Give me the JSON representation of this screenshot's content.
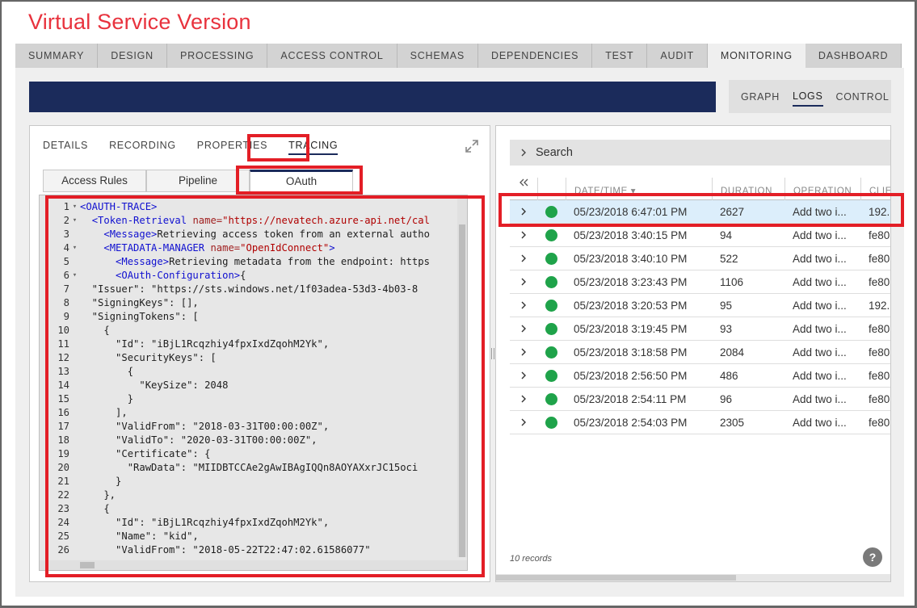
{
  "app": {
    "title": "Virtual Service Version"
  },
  "main_tabs": [
    {
      "label": "SUMMARY"
    },
    {
      "label": "DESIGN"
    },
    {
      "label": "PROCESSING"
    },
    {
      "label": "ACCESS CONTROL"
    },
    {
      "label": "SCHEMAS"
    },
    {
      "label": "DEPENDENCIES"
    },
    {
      "label": "TEST"
    },
    {
      "label": "AUDIT"
    },
    {
      "label": "MONITORING",
      "active": true
    },
    {
      "label": "DASHBOARD"
    }
  ],
  "view_switch": [
    {
      "label": "GRAPH"
    },
    {
      "label": "LOGS",
      "active": true
    },
    {
      "label": "CONTROL"
    }
  ],
  "detail_tabs": [
    {
      "label": "DETAILS"
    },
    {
      "label": "RECORDING"
    },
    {
      "label": "PROPERTIES"
    },
    {
      "label": "TRACING",
      "active": true
    }
  ],
  "sub_tabs": [
    {
      "label": "Access Rules"
    },
    {
      "label": "Pipeline"
    },
    {
      "label": "OAuth",
      "active": true
    }
  ],
  "code": [
    {
      "n": "1",
      "fold": "▾",
      "html": "<span class=\"tag\">&lt;OAUTH-TRACE&gt;</span>"
    },
    {
      "n": "2",
      "fold": "▾",
      "html": "  <span class=\"tag\">&lt;Token-Retrieval</span> <span class=\"attr\">name=</span><span class=\"str\">\"https://nevatech.azure-api.net/cal</span>"
    },
    {
      "n": "3",
      "fold": "",
      "html": "    <span class=\"tag\">&lt;Message&gt;</span>Retrieving access token from an external autho"
    },
    {
      "n": "4",
      "fold": "▾",
      "html": "    <span class=\"tag\">&lt;METADATA-MANAGER</span> <span class=\"attr\">name=</span><span class=\"str\">\"OpenIdConnect\"</span><span class=\"tag\">&gt;</span>"
    },
    {
      "n": "5",
      "fold": "",
      "html": "      <span class=\"tag\">&lt;Message&gt;</span>Retrieving metadata from the endpoint: https"
    },
    {
      "n": "6",
      "fold": "▾",
      "html": "      <span class=\"tag\">&lt;OAuth-Configuration&gt;</span>{"
    },
    {
      "n": "7",
      "fold": "",
      "html": "  \"Issuer\": \"https://sts.windows.net/1f03adea-53d3-4b03-8"
    },
    {
      "n": "8",
      "fold": "",
      "html": "  \"SigningKeys\": [],"
    },
    {
      "n": "9",
      "fold": "",
      "html": "  \"SigningTokens\": ["
    },
    {
      "n": "10",
      "fold": "",
      "html": "    {"
    },
    {
      "n": "11",
      "fold": "",
      "html": "      \"Id\": \"iBjL1Rcqzhiy4fpxIxdZqohM2Yk\","
    },
    {
      "n": "12",
      "fold": "",
      "html": "      \"SecurityKeys\": ["
    },
    {
      "n": "13",
      "fold": "",
      "html": "        {"
    },
    {
      "n": "14",
      "fold": "",
      "html": "          \"KeySize\": 2048"
    },
    {
      "n": "15",
      "fold": "",
      "html": "        }"
    },
    {
      "n": "16",
      "fold": "",
      "html": "      ],"
    },
    {
      "n": "17",
      "fold": "",
      "html": "      \"ValidFrom\": \"2018-03-31T00:00:00Z\","
    },
    {
      "n": "18",
      "fold": "",
      "html": "      \"ValidTo\": \"2020-03-31T00:00:00Z\","
    },
    {
      "n": "19",
      "fold": "",
      "html": "      \"Certificate\": {"
    },
    {
      "n": "20",
      "fold": "",
      "html": "        \"RawData\": \"MIIDBTCCAe2gAwIBAgIQQn8AOYAXxrJC15oci"
    },
    {
      "n": "21",
      "fold": "",
      "html": "      }"
    },
    {
      "n": "22",
      "fold": "",
      "html": "    },"
    },
    {
      "n": "23",
      "fold": "",
      "html": "    {"
    },
    {
      "n": "24",
      "fold": "",
      "html": "      \"Id\": \"iBjL1Rcqzhiy4fpxIxdZqohM2Yk\","
    },
    {
      "n": "25",
      "fold": "",
      "html": "      \"Name\": \"kid\","
    },
    {
      "n": "26",
      "fold": "",
      "html": "      \"ValidFrom\": \"2018-05-22T22:47:02.61586077\""
    }
  ],
  "search": {
    "label": "Search"
  },
  "logs": {
    "columns": [
      "DATE/TIME",
      "DURATION",
      "OPERATION",
      "CLIE"
    ],
    "sort_indicator": "▾",
    "rows": [
      {
        "date": "05/23/2018 6:47:01 PM",
        "duration": "2627",
        "operation": "Add two i...",
        "client": "192.",
        "selected": true
      },
      {
        "date": "05/23/2018 3:40:15 PM",
        "duration": "94",
        "operation": "Add two i...",
        "client": "fe80"
      },
      {
        "date": "05/23/2018 3:40:10 PM",
        "duration": "522",
        "operation": "Add two i...",
        "client": "fe80"
      },
      {
        "date": "05/23/2018 3:23:43 PM",
        "duration": "1106",
        "operation": "Add two i...",
        "client": "fe80"
      },
      {
        "date": "05/23/2018 3:20:53 PM",
        "duration": "95",
        "operation": "Add two i...",
        "client": "192."
      },
      {
        "date": "05/23/2018 3:19:45 PM",
        "duration": "93",
        "operation": "Add two i...",
        "client": "fe80"
      },
      {
        "date": "05/23/2018 3:18:58 PM",
        "duration": "2084",
        "operation": "Add two i...",
        "client": "fe80"
      },
      {
        "date": "05/23/2018 2:56:50 PM",
        "duration": "486",
        "operation": "Add two i...",
        "client": "fe80"
      },
      {
        "date": "05/23/2018 2:54:11 PM",
        "duration": "96",
        "operation": "Add two i...",
        "client": "fe80"
      },
      {
        "date": "05/23/2018 2:54:03 PM",
        "duration": "2305",
        "operation": "Add two i...",
        "client": "fe80"
      }
    ],
    "status_color": "#1fa34a",
    "record_count": "10 records"
  },
  "help": {
    "label": "?"
  },
  "colors": {
    "accent": "#e8323d",
    "banner": "#1b2b5b",
    "highlight": "#e31e26"
  }
}
